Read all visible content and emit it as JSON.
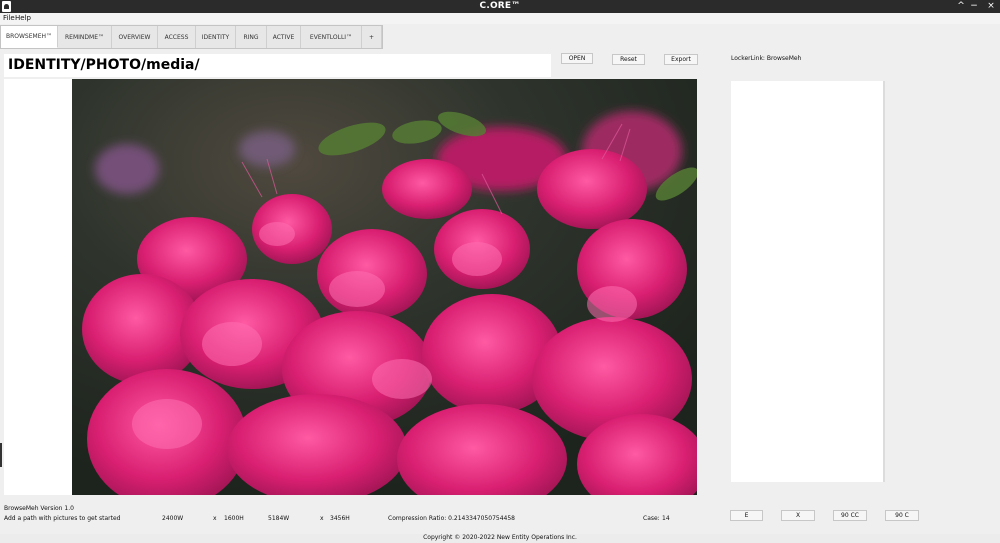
{
  "window": {
    "title": "C.ORE™",
    "controls": [
      "^",
      "−",
      "×"
    ]
  },
  "menu": [
    "File",
    "Help"
  ],
  "tabs": [
    {
      "label": "BROWSEMEH™",
      "active": true
    },
    {
      "label": "REMINDME™",
      "active": false
    },
    {
      "label": "OVERVIEW",
      "active": false
    },
    {
      "label": "ACCESS",
      "active": false
    },
    {
      "label": "IDENTITY",
      "active": false
    },
    {
      "label": "RING",
      "active": false
    },
    {
      "label": "ACTIVE",
      "active": false
    },
    {
      "label": "EVENTLOLLI™",
      "active": false
    },
    {
      "label": "+",
      "active": false
    }
  ],
  "path": "IDENTITY/PHOTO/media/",
  "toolbar": {
    "open": "OPEN",
    "reset": "Reset",
    "export": "Export",
    "locker": "LockerLink: BrowseMeh"
  },
  "footer": {
    "version": "BrowseMeh Version 1.0",
    "hint": "Add a path with pictures to get started",
    "width_display": "2400W",
    "x_display": "x",
    "height_display": "1600H",
    "width_source": "5184W",
    "x_source": "x",
    "height_source": "3456H",
    "compression": "Compression Ratio: 0.2143347050754458",
    "case_label": "Case:",
    "case_value": "14",
    "buttons": [
      "E",
      "X",
      "90 CC",
      "90 C"
    ]
  },
  "copyright": "Copyright © 2020-2022 New Entity Operations Inc.",
  "colors": {
    "accent_magenta": "#d9276f",
    "foliage_dark": "#2f372f"
  }
}
